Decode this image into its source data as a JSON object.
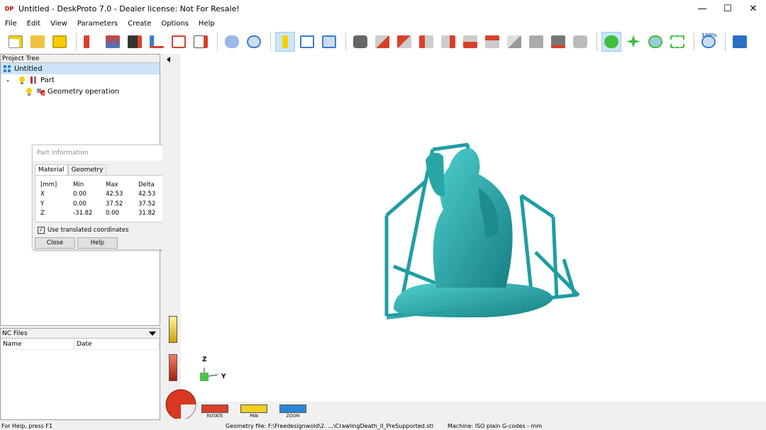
{
  "window": {
    "title": "Untitled - DeskProto 7.0 - Dealer license: Not For Resale!",
    "icon_label": "DP",
    "controls": [
      "minimize-icon",
      "maximize-icon",
      "close-icon"
    ]
  },
  "menu": [
    "File",
    "Edit",
    "View",
    "Parameters",
    "Create",
    "Options",
    "Help"
  ],
  "toolbar": {
    "zoom_badge": "100%",
    "groups": [
      [
        "new-file-icon",
        "open-folder-icon",
        "save-icon"
      ],
      [
        "import-part-icon",
        "wizard-icon",
        "render-icon",
        "toolpath-icon",
        "drawing-icon",
        "export-icon"
      ],
      [
        "view-part-icon",
        "search-icon"
      ],
      [
        "info-icon",
        "layout-icon",
        "panel-icon"
      ],
      [
        "camera-icon",
        "view-front-icon",
        "view-back-icon",
        "view-left-icon",
        "view-right-icon",
        "view-top-icon",
        "view-bottom-icon",
        "view-iso-icon",
        "view-iso2-icon",
        "snapshot-icon",
        "snapshot2-icon"
      ],
      [
        "rotate-icon",
        "pan-icon",
        "zoom-in-icon",
        "zoom-window-icon"
      ],
      [
        "zoom-100-icon"
      ],
      [
        "book-icon"
      ]
    ],
    "active": [
      "info-icon",
      "rotate-icon"
    ],
    "colors": {
      "accent_red": "#d9402b",
      "accent_yellow": "#f0d020",
      "accent_blue": "#2a86d8",
      "accent_green": "#3fbf3f",
      "gray": "#a8a8a8"
    }
  },
  "project_tree": {
    "header": "Project Tree",
    "items": [
      {
        "label": "Untitled",
        "indent": 0,
        "selected": true,
        "icon": "project-icon"
      },
      {
        "label": "Part",
        "indent": 1,
        "selected": false,
        "icon": "part-icon",
        "expand": "chevron-down"
      },
      {
        "label": "Geometry operation",
        "indent": 2,
        "selected": false,
        "icon": "geometry-op-icon"
      }
    ]
  },
  "part_info": {
    "title": "Part Information",
    "tabs": [
      "Material",
      "Geometry"
    ],
    "active_tab": "Material",
    "header": [
      "[mm]",
      "Min",
      "Max",
      "Delta"
    ],
    "rows": [
      [
        "X",
        "0.00",
        "42.53",
        "42.53"
      ],
      [
        "Y",
        "0.00",
        "37.52",
        "37.52"
      ],
      [
        "Z",
        "-31.82",
        "0.00",
        "31.82"
      ]
    ],
    "checkbox_label": "Use translated coordinates",
    "checkbox_checked": true,
    "close_label": "Close",
    "help_label": "Help"
  },
  "nc_files": {
    "header": "NC Files",
    "columns": [
      "Name",
      "Date"
    ]
  },
  "viewport": {
    "model_color": "#2aa5a8",
    "axis": {
      "z_label": "Z",
      "y_label": "Y"
    },
    "nav": [
      {
        "label": "ROTATE",
        "color": "#d9402b"
      },
      {
        "label": "PAN",
        "color": "#f0d020"
      },
      {
        "label": "ZOOM",
        "color": "#2a86d8"
      }
    ]
  },
  "status": {
    "help": "For Help, press F1",
    "geometry": "Geometry file: F:\\Freedesignwold\\2. ...\\CrawlingDeath_II_PreSupported.stl",
    "machine": "Machine: ISO plain G-codes - mm"
  }
}
